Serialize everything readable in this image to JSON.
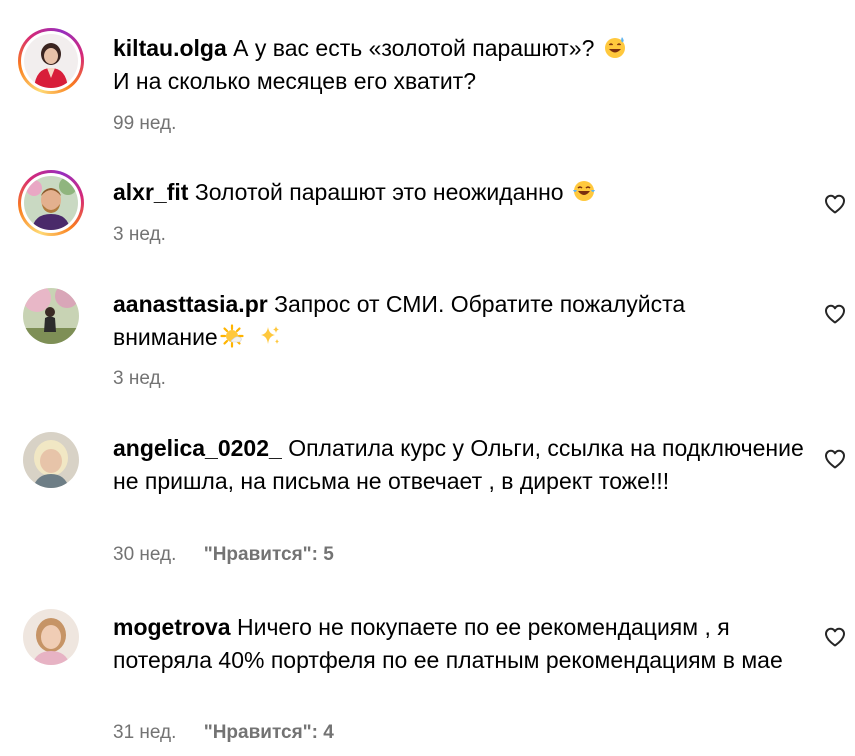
{
  "comments": [
    {
      "username": "kiltau.olga",
      "text": "А у вас есть «золотой парашют»?",
      "text2": "И на сколько месяцев его хватит?",
      "time": "99 нед.",
      "likes": "",
      "emoji": [
        "sweat-smile-emoji"
      ],
      "has_story_ring": true,
      "has_like_button": false
    },
    {
      "username": "alxr_fit",
      "text": "Золотой парашют это неожиданно",
      "time": "3 нед.",
      "likes": "",
      "emoji": [
        "tears-of-joy-emoji"
      ],
      "has_story_ring": true,
      "has_like_button": true
    },
    {
      "username": "aanasttasia.pr",
      "text": "Запрос от СМИ. Обратите пожалуйста",
      "text2": "внимание",
      "time": "3 нед.",
      "likes": "",
      "emoji": [
        "sun-emoji",
        "sparkles-emoji"
      ],
      "has_story_ring": false,
      "has_like_button": true
    },
    {
      "username": "angelica_0202_",
      "text": "Оплатила курс у Ольги, ссылка на подключение не пришла, на письма не отвечает , в директ тоже!!!",
      "time": "30 нед.",
      "likes": "\"Нравится\": 5",
      "has_story_ring": false,
      "has_like_button": true
    },
    {
      "username": "mogetrova",
      "text": "Ничего не покупаете по ее рекомендациям , я потеряла 40% портфеля по ее платным рекомендациям в мае",
      "time": "31 нед.",
      "likes": "\"Нравится\": 4",
      "has_story_ring": false,
      "has_like_button": true
    }
  ],
  "colors": {
    "meta_text": "#737373",
    "ring_gradient": [
      "#feda75",
      "#fa7e1e",
      "#d62976",
      "#962fbf"
    ]
  }
}
